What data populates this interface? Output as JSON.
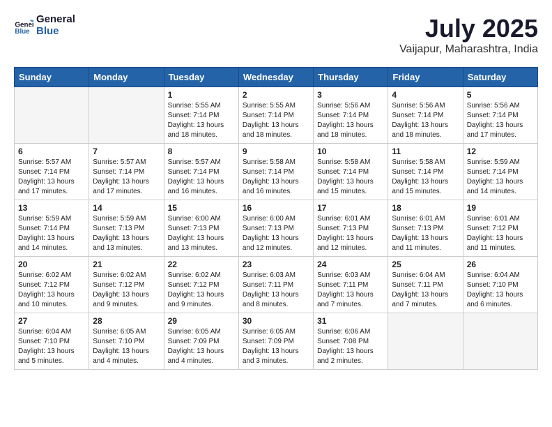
{
  "logo": {
    "line1": "General",
    "line2": "Blue"
  },
  "title": "July 2025",
  "location": "Vaijapur, Maharashtra, India",
  "headers": [
    "Sunday",
    "Monday",
    "Tuesday",
    "Wednesday",
    "Thursday",
    "Friday",
    "Saturday"
  ],
  "weeks": [
    [
      {
        "day": "",
        "text": ""
      },
      {
        "day": "",
        "text": ""
      },
      {
        "day": "1",
        "text": "Sunrise: 5:55 AM\nSunset: 7:14 PM\nDaylight: 13 hours\nand 18 minutes."
      },
      {
        "day": "2",
        "text": "Sunrise: 5:55 AM\nSunset: 7:14 PM\nDaylight: 13 hours\nand 18 minutes."
      },
      {
        "day": "3",
        "text": "Sunrise: 5:56 AM\nSunset: 7:14 PM\nDaylight: 13 hours\nand 18 minutes."
      },
      {
        "day": "4",
        "text": "Sunrise: 5:56 AM\nSunset: 7:14 PM\nDaylight: 13 hours\nand 18 minutes."
      },
      {
        "day": "5",
        "text": "Sunrise: 5:56 AM\nSunset: 7:14 PM\nDaylight: 13 hours\nand 17 minutes."
      }
    ],
    [
      {
        "day": "6",
        "text": "Sunrise: 5:57 AM\nSunset: 7:14 PM\nDaylight: 13 hours\nand 17 minutes."
      },
      {
        "day": "7",
        "text": "Sunrise: 5:57 AM\nSunset: 7:14 PM\nDaylight: 13 hours\nand 17 minutes."
      },
      {
        "day": "8",
        "text": "Sunrise: 5:57 AM\nSunset: 7:14 PM\nDaylight: 13 hours\nand 16 minutes."
      },
      {
        "day": "9",
        "text": "Sunrise: 5:58 AM\nSunset: 7:14 PM\nDaylight: 13 hours\nand 16 minutes."
      },
      {
        "day": "10",
        "text": "Sunrise: 5:58 AM\nSunset: 7:14 PM\nDaylight: 13 hours\nand 15 minutes."
      },
      {
        "day": "11",
        "text": "Sunrise: 5:58 AM\nSunset: 7:14 PM\nDaylight: 13 hours\nand 15 minutes."
      },
      {
        "day": "12",
        "text": "Sunrise: 5:59 AM\nSunset: 7:14 PM\nDaylight: 13 hours\nand 14 minutes."
      }
    ],
    [
      {
        "day": "13",
        "text": "Sunrise: 5:59 AM\nSunset: 7:14 PM\nDaylight: 13 hours\nand 14 minutes."
      },
      {
        "day": "14",
        "text": "Sunrise: 5:59 AM\nSunset: 7:13 PM\nDaylight: 13 hours\nand 13 minutes."
      },
      {
        "day": "15",
        "text": "Sunrise: 6:00 AM\nSunset: 7:13 PM\nDaylight: 13 hours\nand 13 minutes."
      },
      {
        "day": "16",
        "text": "Sunrise: 6:00 AM\nSunset: 7:13 PM\nDaylight: 13 hours\nand 12 minutes."
      },
      {
        "day": "17",
        "text": "Sunrise: 6:01 AM\nSunset: 7:13 PM\nDaylight: 13 hours\nand 12 minutes."
      },
      {
        "day": "18",
        "text": "Sunrise: 6:01 AM\nSunset: 7:13 PM\nDaylight: 13 hours\nand 11 minutes."
      },
      {
        "day": "19",
        "text": "Sunrise: 6:01 AM\nSunset: 7:12 PM\nDaylight: 13 hours\nand 11 minutes."
      }
    ],
    [
      {
        "day": "20",
        "text": "Sunrise: 6:02 AM\nSunset: 7:12 PM\nDaylight: 13 hours\nand 10 minutes."
      },
      {
        "day": "21",
        "text": "Sunrise: 6:02 AM\nSunset: 7:12 PM\nDaylight: 13 hours\nand 9 minutes."
      },
      {
        "day": "22",
        "text": "Sunrise: 6:02 AM\nSunset: 7:12 PM\nDaylight: 13 hours\nand 9 minutes."
      },
      {
        "day": "23",
        "text": "Sunrise: 6:03 AM\nSunset: 7:11 PM\nDaylight: 13 hours\nand 8 minutes."
      },
      {
        "day": "24",
        "text": "Sunrise: 6:03 AM\nSunset: 7:11 PM\nDaylight: 13 hours\nand 7 minutes."
      },
      {
        "day": "25",
        "text": "Sunrise: 6:04 AM\nSunset: 7:11 PM\nDaylight: 13 hours\nand 7 minutes."
      },
      {
        "day": "26",
        "text": "Sunrise: 6:04 AM\nSunset: 7:10 PM\nDaylight: 13 hours\nand 6 minutes."
      }
    ],
    [
      {
        "day": "27",
        "text": "Sunrise: 6:04 AM\nSunset: 7:10 PM\nDaylight: 13 hours\nand 5 minutes."
      },
      {
        "day": "28",
        "text": "Sunrise: 6:05 AM\nSunset: 7:10 PM\nDaylight: 13 hours\nand 4 minutes."
      },
      {
        "day": "29",
        "text": "Sunrise: 6:05 AM\nSunset: 7:09 PM\nDaylight: 13 hours\nand 4 minutes."
      },
      {
        "day": "30",
        "text": "Sunrise: 6:05 AM\nSunset: 7:09 PM\nDaylight: 13 hours\nand 3 minutes."
      },
      {
        "day": "31",
        "text": "Sunrise: 6:06 AM\nSunset: 7:08 PM\nDaylight: 13 hours\nand 2 minutes."
      },
      {
        "day": "",
        "text": ""
      },
      {
        "day": "",
        "text": ""
      }
    ]
  ]
}
